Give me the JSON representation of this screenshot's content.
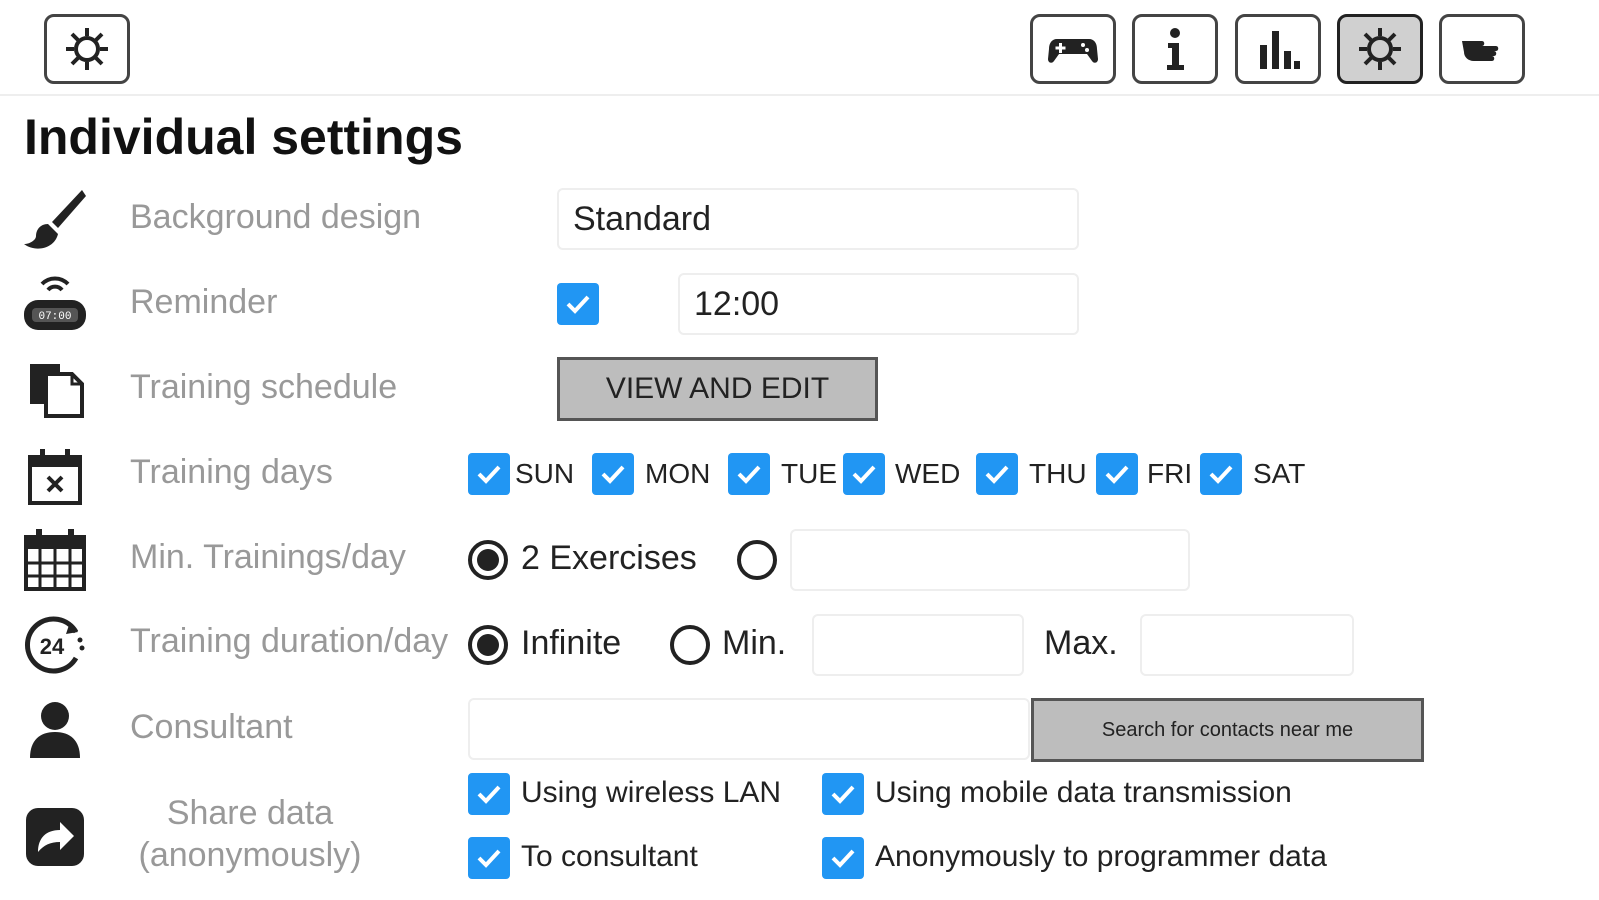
{
  "toolbar": {
    "left_icon": "gear-icon",
    "right_icons": [
      "gamepad-icon",
      "info-icon",
      "bar-chart-icon",
      "gear-icon",
      "hand-pointer-icon"
    ],
    "active_index": 3
  },
  "page": {
    "title": "Individual settings"
  },
  "background_design": {
    "label": "Background design",
    "value": "Standard",
    "icon": "paintbrush-icon"
  },
  "reminder": {
    "label": "Reminder",
    "checked": true,
    "time": "12:00",
    "icon": "alarm-clock-icon"
  },
  "training_schedule": {
    "label": "Training schedule",
    "button": "VIEW AND EDIT",
    "icon": "documents-icon"
  },
  "training_days": {
    "label": "Training days",
    "icon": "calendar-x-icon",
    "days": [
      {
        "label": "SUN",
        "checked": true
      },
      {
        "label": "MON",
        "checked": true
      },
      {
        "label": "TUE",
        "checked": true
      },
      {
        "label": "WED",
        "checked": true
      },
      {
        "label": "THU",
        "checked": true
      },
      {
        "label": "FRI",
        "checked": true
      },
      {
        "label": "SAT",
        "checked": true
      }
    ]
  },
  "min_trainings": {
    "label": "Min. Trainings/day",
    "option1": "2 Exercises",
    "selected": "option1",
    "custom_value": "",
    "icon": "calendar-grid-icon"
  },
  "training_duration": {
    "label": "Training duration/day",
    "option_infinite": "Infinite",
    "option_min": "Min.",
    "max_label": "Max.",
    "min_value": "",
    "max_value": "",
    "selected": "infinite",
    "icon": "24h-clock-icon"
  },
  "consultant": {
    "label": "Consultant",
    "value": "",
    "button": "Search for contacts near me",
    "icon": "person-icon"
  },
  "share_data": {
    "label_line1": "Share data",
    "label_line2": "(anonymously)",
    "icon": "share-arrow-icon",
    "options": [
      {
        "label": "Using wireless LAN",
        "checked": true
      },
      {
        "label": "Using mobile data transmission",
        "checked": true
      },
      {
        "label": "To consultant",
        "checked": true
      },
      {
        "label": "Anonymously to programmer data",
        "checked": true
      }
    ]
  },
  "colors": {
    "accent": "#2196f3",
    "label_gray": "#999999",
    "button_gray": "#bdbdbd"
  }
}
